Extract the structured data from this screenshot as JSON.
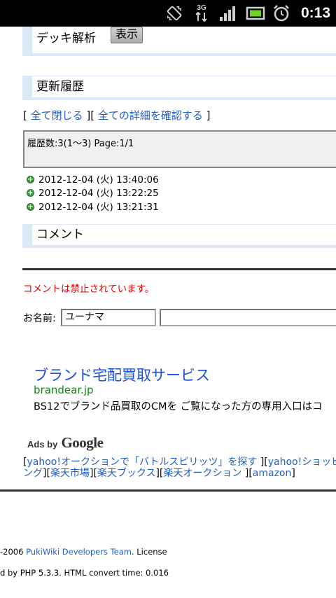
{
  "status_bar": {
    "time": "0:13",
    "network": "3G"
  },
  "deck": {
    "label": "デッキ解析",
    "show_button": "表示"
  },
  "update_history": {
    "heading": "更新履歴",
    "close_all": "全て閉じる",
    "view_details": "全ての詳細を確認する",
    "summary": "履歴数:3(1〜3) Page:1/1",
    "items": [
      "2012-12-04 (火) 13:40:06",
      "2012-12-04 (火) 13:22:25",
      "2012-12-04 (火) 13:21:31"
    ]
  },
  "comment": {
    "heading": "コメント",
    "notice": "コメントは禁止されています。",
    "name_label": "お名前:",
    "name_value": "ユーナマ"
  },
  "ad": {
    "title": "ブランド宅配買取サービス",
    "url": "brandear.jp",
    "description": "BS12でブランド品買取のCMを ご覧になった方の専用入口はコ",
    "ads_by": "Ads by",
    "google": "Google"
  },
  "shop_links": {
    "yahoo_auction": "yahoo!オークションで「バトルスピリッツ」を探す",
    "yahoo_shopping": "yahoo!ショッピング",
    "rakuten_market": "楽天市場",
    "rakuten_books": "楽天ブックス",
    "rakuten_auction": "楽天オークション",
    "amazon": "amazon"
  },
  "footer": {
    "copyright_prefix": "-2006 ",
    "team": "PukiWiki Developers Team",
    "license": ". License",
    "powered": "d by PHP 5.3.3. HTML convert time: 0.016"
  },
  "colors": {
    "link": "#215dc6",
    "section_border": "#dbe8f8",
    "notice": "#dd0000",
    "ad_title": "#1a4fd6",
    "ad_url": "#118811"
  }
}
